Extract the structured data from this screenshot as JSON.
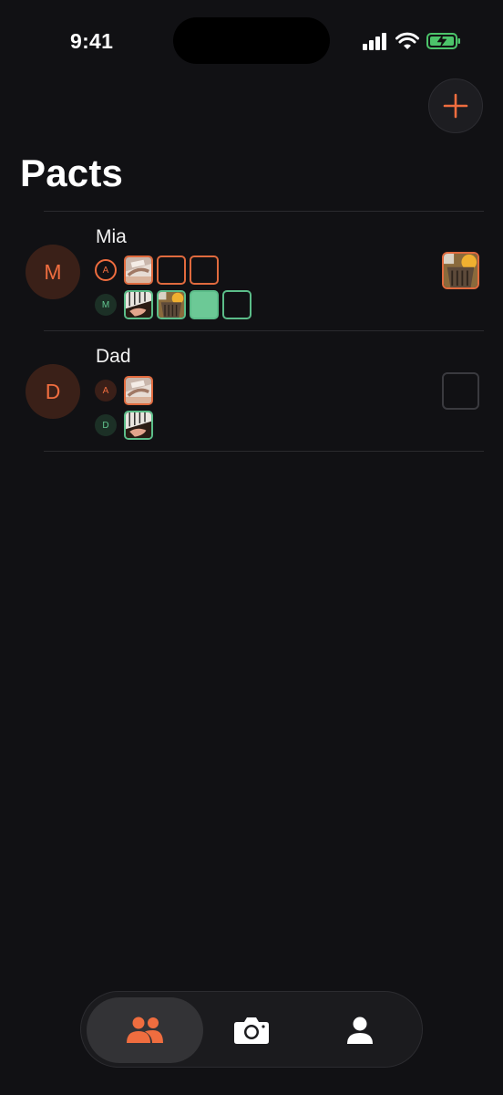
{
  "status_bar": {
    "time": "9:41"
  },
  "header": {
    "title": "Pacts"
  },
  "pacts": [
    {
      "name": "Mia",
      "initial": "M",
      "rows": [
        {
          "member": "A",
          "slots": [
            "photo-scroll",
            "empty",
            "empty"
          ]
        },
        {
          "member": "M",
          "slots": [
            "photo-piano",
            "photo-bucket",
            "filled",
            "empty"
          ]
        }
      ],
      "today": "photo-bucket"
    },
    {
      "name": "Dad",
      "initial": "D",
      "rows": [
        {
          "member": "A",
          "slots": [
            "photo-scroll"
          ]
        },
        {
          "member": "D",
          "slots": [
            "photo-piano"
          ]
        }
      ],
      "today": "empty"
    }
  ],
  "tabs": [
    {
      "name": "pacts",
      "icon": "people-icon",
      "active": true
    },
    {
      "name": "camera",
      "icon": "camera-icon",
      "active": false
    },
    {
      "name": "profile",
      "icon": "person-icon",
      "active": false
    }
  ],
  "colors": {
    "accent": "#ef6d3f",
    "green": "#5bbd89",
    "background": "#111114"
  }
}
